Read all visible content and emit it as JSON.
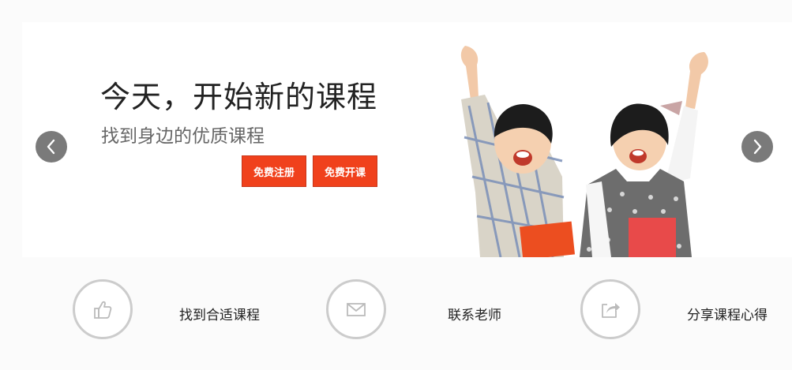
{
  "banner": {
    "title": "今天，开始新的课程",
    "subtitle": "找到身边的优质课程",
    "register_button": "免费注册",
    "open_course_button": "免费开课",
    "prev_icon": "chevron-left-icon",
    "next_icon": "chevron-right-icon"
  },
  "features": [
    {
      "icon": "thumbs-up-icon",
      "label": "找到合适课程"
    },
    {
      "icon": "envelope-icon",
      "label": "联系老师"
    },
    {
      "icon": "share-icon",
      "label": "分享课程心得"
    }
  ],
  "colors": {
    "accent": "#f0411c",
    "arrow_bg": "#7a7a7a",
    "feature_ring": "#cccccc"
  }
}
